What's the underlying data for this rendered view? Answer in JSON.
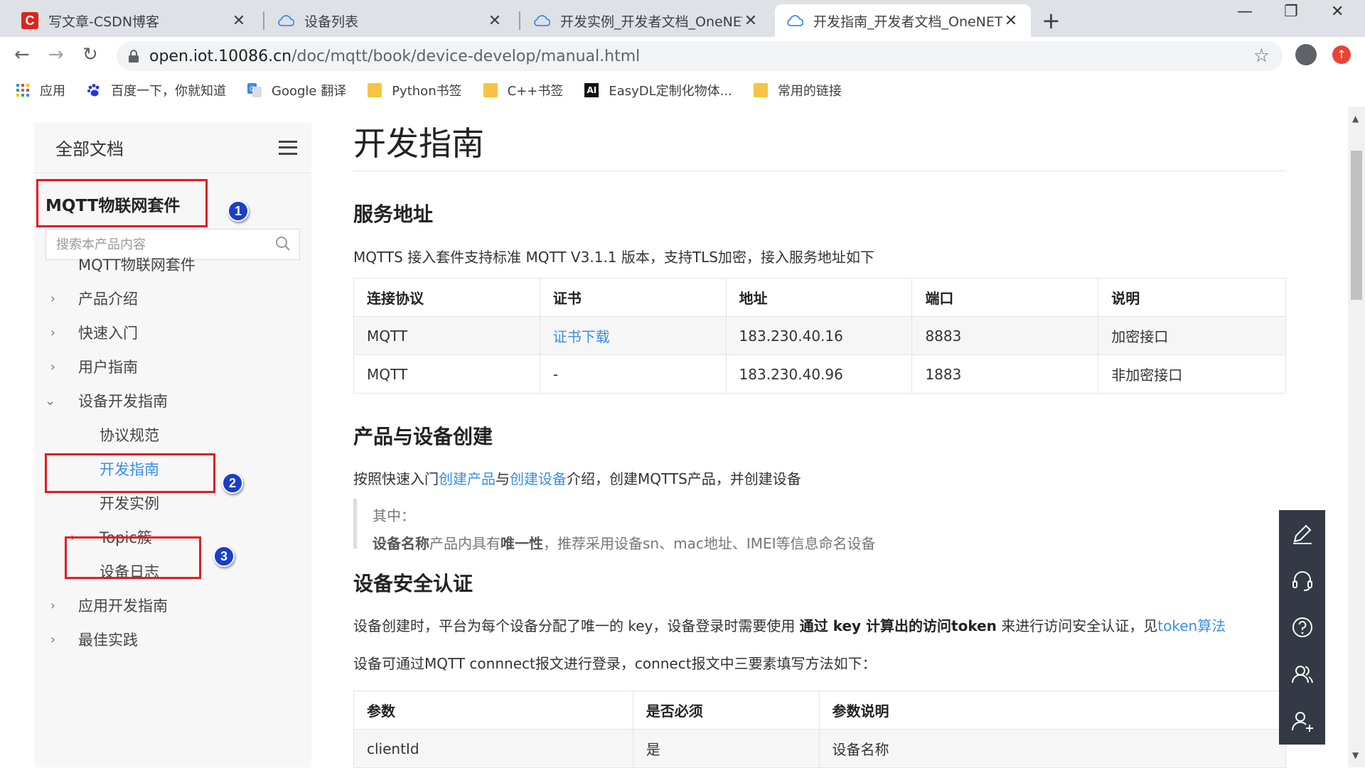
{
  "browser": {
    "tabs": [
      {
        "title": "写文章-CSDN博客",
        "icon": "csdn-logo"
      },
      {
        "title": "设备列表",
        "icon": "cloud-icon"
      },
      {
        "title": "开发实例_开发者文档_OneNET",
        "icon": "cloud-icon"
      },
      {
        "title": "开发指南_开发者文档_OneNET",
        "icon": "cloud-icon",
        "active": true
      }
    ],
    "url_host": "open.iot.10086.cn",
    "url_path": "/doc/mqtt/book/device-develop/manual.html",
    "csdn_letter": "C",
    "bookmarks": [
      {
        "label": "应用",
        "icon": "apps-grid-icon"
      },
      {
        "label": "百度一下，你就知道",
        "icon": "baidu-paw-icon"
      },
      {
        "label": "Google 翻译",
        "icon": "google-translate-icon"
      },
      {
        "label": "Python书签",
        "icon": "folder-icon"
      },
      {
        "label": "C++书签",
        "icon": "folder-icon"
      },
      {
        "label": "EasyDL定制化物体...",
        "icon": "ai-icon"
      },
      {
        "label": "常用的链接",
        "icon": "folder-icon"
      }
    ],
    "ai_badge": "AI"
  },
  "sidebar": {
    "header": "全部文档",
    "product": "MQTT物联网套件",
    "search_placeholder": "搜索本产品内容",
    "items": [
      {
        "label": "MQTT物联网套件"
      },
      {
        "label": "产品介绍"
      },
      {
        "label": "快速入门"
      },
      {
        "label": "用户指南"
      },
      {
        "label": "设备开发指南"
      },
      {
        "label": "协议规范"
      },
      {
        "label": "开发指南"
      },
      {
        "label": "开发实例"
      },
      {
        "label": "Topic簇"
      },
      {
        "label": "设备日志"
      },
      {
        "label": "应用开发指南"
      },
      {
        "label": "最佳实践"
      }
    ],
    "annotations": [
      "1",
      "2",
      "3"
    ]
  },
  "content": {
    "title": "开发指南",
    "section1": {
      "heading": "服务地址",
      "intro": "MQTTS 接入套件支持标准 MQTT V3.1.1 版本，支持TLS加密，接入服务地址如下",
      "columns": [
        "连接协议",
        "证书",
        "地址",
        "端口",
        "说明"
      ],
      "rows": [
        [
          "MQTT",
          "证书下载",
          "183.230.40.16",
          "8883",
          "加密接口"
        ],
        [
          "MQTT",
          "-",
          "183.230.40.96",
          "1883",
          "非加密接口"
        ]
      ]
    },
    "section2": {
      "heading": "产品与设备创建",
      "text_pre": "按照快速入门",
      "link1": "创建产品",
      "text_mid": "与",
      "link2": "创建设备",
      "text_post": "介绍，创建MQTTS产品，并创建设备",
      "quote_line1": "其中：",
      "quote_b1": "设备名称",
      "quote_t1": "产品内具有",
      "quote_b2": "唯一性",
      "quote_t2": "，推荐采用设备sn、mac地址、IMEI等信息命名设备"
    },
    "section3": {
      "heading": "设备安全认证",
      "p1_pre": "设备创建时，平台为每个设备分配了唯一的 key，设备登录时需要使用 ",
      "p1_bold": "通过 key 计算出的访问token",
      "p1_post": " 来进行访问安全认证，见",
      "p1_link": "token算法",
      "p2": "设备可通过MQTT connnect报文进行登录，connect报文中三要素填写方法如下：",
      "columns": [
        "参数",
        "是否必须",
        "参数说明"
      ],
      "rows": [
        [
          "clientId",
          "是",
          "设备名称"
        ]
      ]
    }
  },
  "floating_toolbar": [
    "edit-icon",
    "headset-icon",
    "help-icon",
    "community-icon",
    "user-add-icon"
  ]
}
